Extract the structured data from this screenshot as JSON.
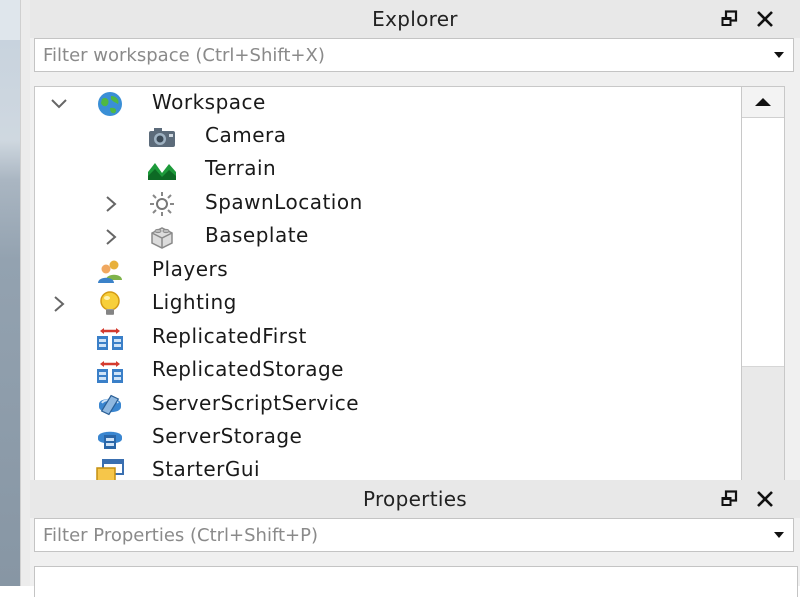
{
  "explorer": {
    "title": "Explorer",
    "filter_placeholder": "Filter workspace (Ctrl+Shift+X)",
    "items": [
      {
        "label": "Workspace",
        "icon": "globe-icon",
        "arrow": "expanded"
      },
      {
        "label": "Camera",
        "icon": "camera-icon",
        "arrow": "none"
      },
      {
        "label": "Terrain",
        "icon": "terrain-icon",
        "arrow": "none"
      },
      {
        "label": "SpawnLocation",
        "icon": "spawn-icon",
        "arrow": "collapsed"
      },
      {
        "label": "Baseplate",
        "icon": "part-icon",
        "arrow": "collapsed"
      },
      {
        "label": "Players",
        "icon": "players-icon",
        "arrow": "none"
      },
      {
        "label": "Lighting",
        "icon": "lightbulb-icon",
        "arrow": "collapsed"
      },
      {
        "label": "ReplicatedFirst",
        "icon": "replicated-icon",
        "arrow": "none"
      },
      {
        "label": "ReplicatedStorage",
        "icon": "replicated-icon",
        "arrow": "none"
      },
      {
        "label": "ServerScriptService",
        "icon": "script-service-icon",
        "arrow": "none"
      },
      {
        "label": "ServerStorage",
        "icon": "server-storage-icon",
        "arrow": "none"
      },
      {
        "label": "StarterGui",
        "icon": "gui-icon",
        "arrow": "none"
      }
    ]
  },
  "properties": {
    "title": "Properties",
    "filter_placeholder": "Filter Properties (Ctrl+Shift+P)"
  },
  "colors": {
    "header_bg": "#e8e8e8",
    "panel_bg": "#f0f0f0",
    "tree_bg": "#ffffff"
  }
}
